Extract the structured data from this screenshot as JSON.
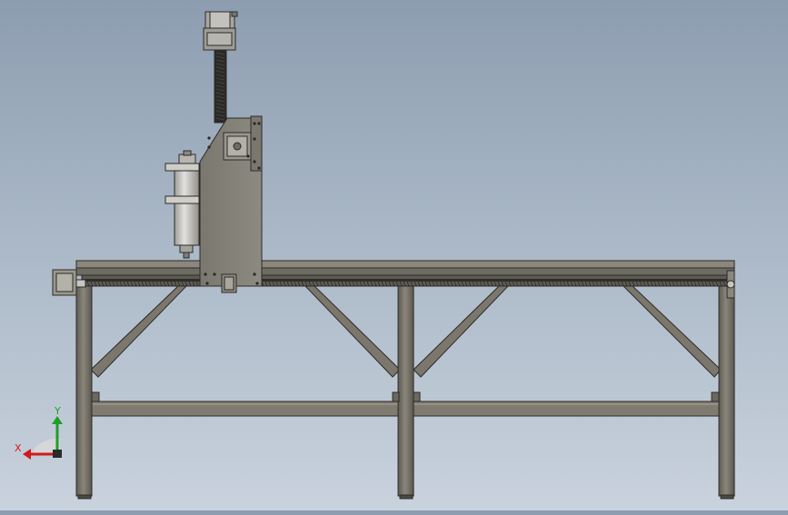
{
  "viewport": {
    "background_top": "#8d9db0",
    "background_bottom": "#c9d2dd"
  },
  "model": {
    "frame_color": "#7b776c",
    "frame_edge_color": "#2c2b27",
    "carriage_color": "#85827a",
    "spindle_color": "#c9c8c4",
    "rail_color": "#6e6b63"
  },
  "triad": {
    "x_label": "X",
    "y_label": "Y",
    "x_color": "#d11a1a",
    "y_color": "#1e9e2a",
    "z_color": "#d8d8d8"
  }
}
